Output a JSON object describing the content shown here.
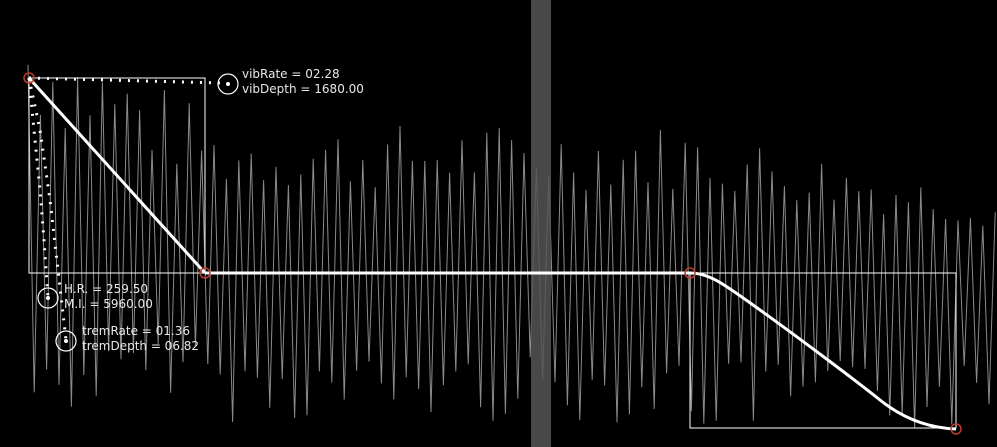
{
  "colors": {
    "background": "#000000",
    "waveform": "#8a8a8a",
    "envelope": "#ffffff",
    "breakpoint": "#c0392b",
    "playhead": "#555555",
    "text": "#e8e8e8"
  },
  "params": {
    "vibRate": "vibRate = 02.28",
    "vibDepth": "vibDepth = 1680.00",
    "hr": "H.R. = 259.50",
    "mi": "M.I. = 5960.00",
    "tremRate": "tremRate = 01.36",
    "tremDepth": "tremDepth = 06.82"
  }
}
